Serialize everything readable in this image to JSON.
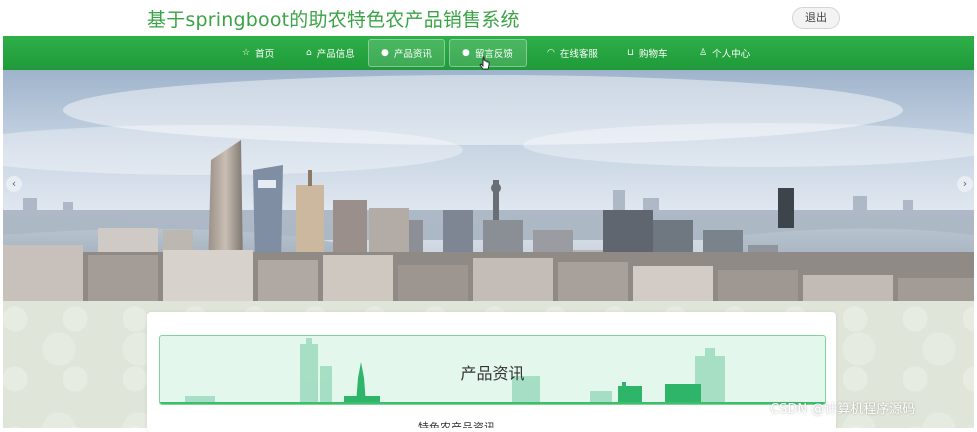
{
  "header": {
    "site_title": "基于springboot的助农特色农产品销售系统",
    "logout_label": "退出"
  },
  "nav": {
    "items": [
      {
        "label": "首页",
        "icon": "star-icon"
      },
      {
        "label": "产品信息",
        "icon": "home-icon"
      },
      {
        "label": "产品资讯",
        "icon": "dot-icon",
        "active": true
      },
      {
        "label": "留言反馈",
        "icon": "dot-icon",
        "active": true
      },
      {
        "label": "在线客服",
        "icon": "headset-icon"
      },
      {
        "label": "购物车",
        "icon": "cart-icon"
      },
      {
        "label": "个人中心",
        "icon": "user-icon"
      }
    ]
  },
  "banner": {
    "prev_glyph": "‹",
    "next_glyph": "›",
    "image_subject": "city skyline panorama"
  },
  "section": {
    "title": "产品资讯",
    "accent_color": "#3cbf6a"
  },
  "content": {
    "first_item_partial": "特色农产品资讯"
  },
  "watermark": "CSDN @计算机程序源码",
  "colors": {
    "nav_green": "#22a33e",
    "title_green": "#3aa346",
    "section_bg": "#e4f7ec"
  }
}
